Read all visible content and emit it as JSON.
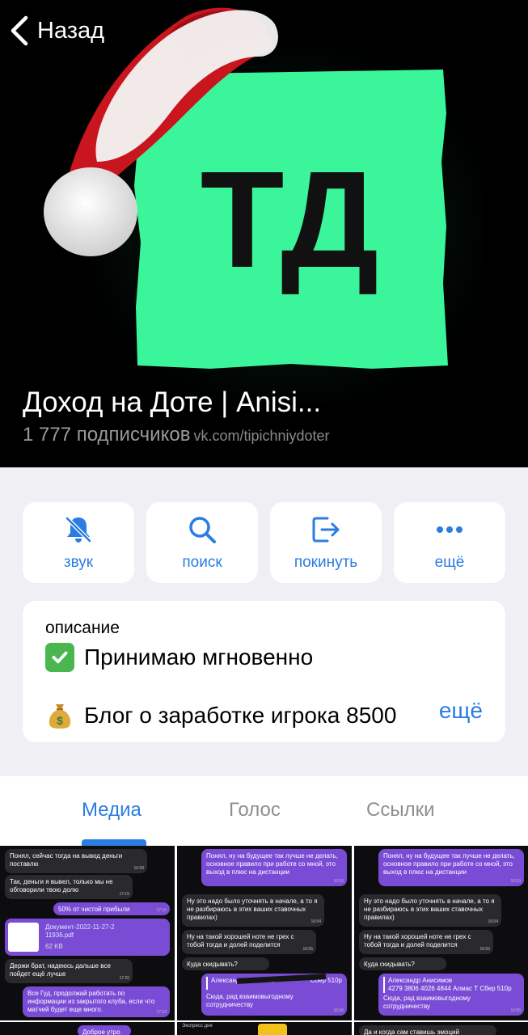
{
  "nav": {
    "back_label": "Назад"
  },
  "channel": {
    "title": "Доход на Доте | Anisi...",
    "subscribers": "1 777 подписчиков",
    "watermark": "vk.com/tipichniydoter",
    "avatar_text": "ТД"
  },
  "actions": [
    {
      "label": "звук",
      "icon": "bell-slash-icon"
    },
    {
      "label": "поиск",
      "icon": "search-icon"
    },
    {
      "label": "покинуть",
      "icon": "leave-icon"
    },
    {
      "label": "ещё",
      "icon": "more-dots-icon"
    }
  ],
  "description": {
    "caption": "описание",
    "line1": "Принимаю мгновенно",
    "line2": "Блог о заработке игрока 8500",
    "more_label": "ещё"
  },
  "tabs": [
    {
      "label": "Медиа",
      "active": true
    },
    {
      "label": "Голос",
      "active": false
    },
    {
      "label": "Ссылки",
      "active": false
    }
  ],
  "media": {
    "cell1": {
      "m1": "Понял, сейчас тогда на вывод деньги поставлю",
      "m2": "Так, деньги я вывел, только мы не обговорили твою долю",
      "m3": "50% от чистой прибыли",
      "m4": "Документ-2022-11-27-2 11936.pdf",
      "m4b": "62 KB",
      "m5": "Держи брат, надеюсь дальше все пойдет ещё лучше",
      "m6": "Все Гуд, продолжай работать по информации из закрытого клуба, если что матчей будет еще много.",
      "m7": "Доброе утро"
    },
    "cell2": {
      "m1": "Понял, ну на будущее так лучше не делать, основное правило при работе со мной, это выход в плюс на дистанции",
      "m2": "Ну это надо было уточнять в начале, а то я не разбираюсь в этих ваших ставочных правилах)",
      "m3": "Ну на такой хорошей ноте не грех с тобой тогда и долей поделится",
      "m4": "Куда скидывать?",
      "m5": "Александр Анисимов",
      "m5b": "Сбер 510р",
      "m6": "Сюда, рад взаимовыгодному сотрудничеству",
      "m7": "Экспресс дня"
    },
    "cell3": {
      "m1": "Понял, ну на будущее так лучше не делать, основное правило при работе со мной, это выход в плюс на дистанции",
      "m2": "Ну это надо было уточнять в начале, а то я не разбираюсь в этих ваших ставочных правилах)",
      "m3": "Ну на такой хорошей ноте не грех с тобой тогда и долей поделится",
      "m4": "Куда скидывать?",
      "m5": "Александр Анисимов",
      "m5b": "4279 3806 4026 4844 Алмас Т Сбер 510р",
      "m6": "Сюда, рад взаимовыгодному сотрудничеству",
      "m7": "Да и когда сам ставишь эмоций"
    }
  },
  "colors": {
    "accent": "#2a7de1",
    "avatar_green": "#3af59a",
    "bubble_purple": "#7a4cd6"
  }
}
